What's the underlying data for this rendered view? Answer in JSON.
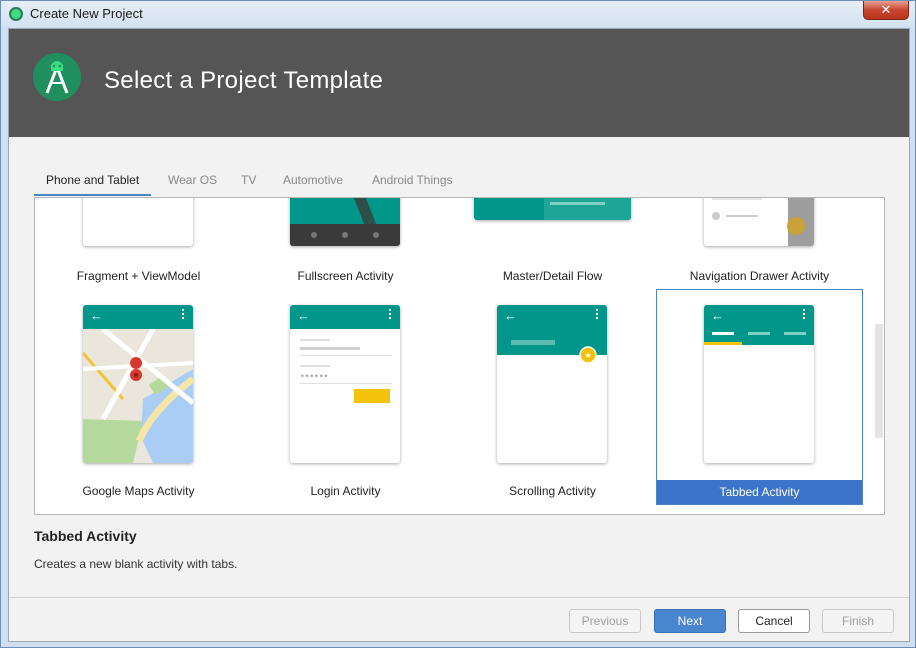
{
  "window": {
    "title": "Create New Project",
    "close_glyph": "✕"
  },
  "header": {
    "title": "Select a Project Template",
    "logo_icon": "android-studio-icon"
  },
  "tabs": [
    {
      "label": "Phone and Tablet",
      "active": true
    },
    {
      "label": "Wear OS",
      "active": false
    },
    {
      "label": "TV",
      "active": false
    },
    {
      "label": "Automotive",
      "active": false
    },
    {
      "label": "Android Things",
      "active": false
    }
  ],
  "templates": {
    "row1": [
      "Fragment + ViewModel",
      "Fullscreen Activity",
      "Master/Detail Flow",
      "Navigation Drawer Activity"
    ],
    "row2": [
      "Google Maps Activity",
      "Login Activity",
      "Scrolling Activity",
      "Tabbed Activity"
    ],
    "selected": "Tabbed Activity"
  },
  "description": {
    "title": "Tabbed Activity",
    "text": "Creates a new blank activity with tabs."
  },
  "buttons": {
    "previous": "Previous",
    "next": "Next",
    "cancel": "Cancel",
    "finish": "Finish"
  },
  "colors": {
    "accent": "#00968a",
    "selection": "#3b74c9",
    "header_bg": "#555555",
    "fab": "#f4c20d"
  }
}
